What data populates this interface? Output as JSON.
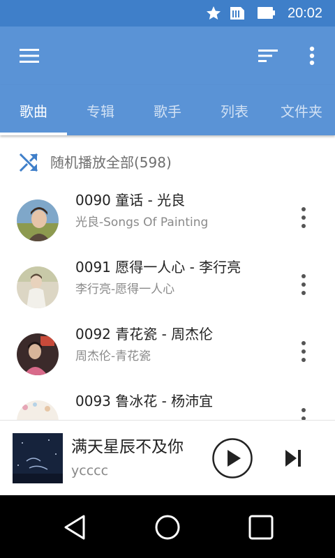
{
  "status_bar": {
    "time": "20:02",
    "icons": [
      "star-icon",
      "sim-card-icon",
      "battery-icon"
    ]
  },
  "app_bar": {
    "icons": [
      "menu-icon",
      "sort-icon",
      "more-vert-icon"
    ],
    "color": "#5a93d6"
  },
  "tabs": [
    {
      "label": "歌曲",
      "active": true
    },
    {
      "label": "专辑",
      "active": false
    },
    {
      "label": "歌手",
      "active": false
    },
    {
      "label": "列表",
      "active": false
    },
    {
      "label": "文件夹",
      "active": false
    }
  ],
  "shuffle": {
    "label": "随机播放全部(598)",
    "icon": "shuffle-icon"
  },
  "songs": [
    {
      "title": "0090 童话 - 光良",
      "subtitle": "光良-Songs Of Painting"
    },
    {
      "title": "0091 愿得一人心 - 李行亮",
      "subtitle": "李行亮-愿得一人心"
    },
    {
      "title": "0092 青花瓷 - 周杰伦",
      "subtitle": "周杰伦-青花瓷"
    },
    {
      "title": "0093 鲁冰花 - 杨沛宜",
      "subtitle": ""
    }
  ],
  "player": {
    "title": "满天星辰不及你",
    "artist": "ycccc",
    "icons": [
      "play-icon",
      "skip-next-icon"
    ]
  },
  "nav_bar": {
    "icons": [
      "back-icon",
      "home-icon",
      "recents-icon"
    ]
  },
  "colors": {
    "status_bar": "#3f7fc9",
    "accent": "#5a93d6",
    "shuffle_icon": "#3f7fc9"
  }
}
